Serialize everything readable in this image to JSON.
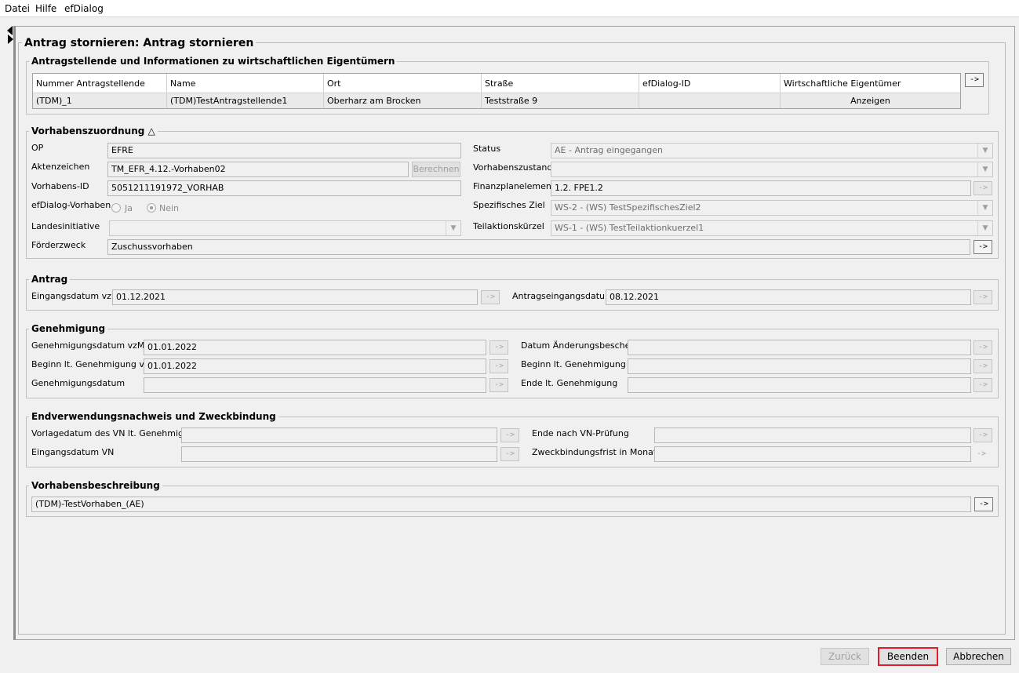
{
  "menu": {
    "datei": "Datei",
    "hilfe": "Hilfe",
    "efdialog": "efDialog"
  },
  "page_title": "Antrag stornieren: Antrag stornieren",
  "applicants": {
    "title": "Antragstellende und Informationen zu wirtschaftlichen Eigentümern",
    "columns": [
      "Nummer Antragstellende",
      "Name",
      "Ort",
      "Straße",
      "efDialog-ID",
      "Wirtschaftliche Eigentümer"
    ],
    "row": [
      "(TDM)_1",
      "(TDM)TestAntragstellende1",
      "Oberharz am Brocken",
      "Teststraße 9",
      "",
      "Anzeigen"
    ],
    "arrow": "->"
  },
  "vorhaben": {
    "title": "Vorhabenszuordnung",
    "op_label": "OP",
    "op_value": "EFRE",
    "akten_label": "Aktenzeichen",
    "akten_value": "TM_EFR_4.12.-Vorhaben02",
    "berechnen": "Berechnen",
    "vid_label": "Vorhabens-ID",
    "vid_value": "5051211191972_VORHAB",
    "efd_label": "efDialog-Vorhaben",
    "ja": "Ja",
    "nein": "Nein",
    "landes_label": "Landesinitiative",
    "landes_value": "",
    "zweck_label": "Förderzweck",
    "zweck_value": "Zuschussvorhaben",
    "status_label": "Status",
    "status_value": "AE - Antrag eingegangen",
    "zustand_label": "Vorhabenszustand",
    "zustand_value": "",
    "fin_label": "Finanzplanelement",
    "fin_value": "1.2. FPE1.2",
    "ziel_label": "Spezifisches Ziel",
    "ziel_value": "WS-2 - (WS) TestSpezifischesZiel2",
    "teil_label": "Teilaktionskürzel",
    "teil_value": "WS-1 - (WS) TestTeilaktionkuerzel1",
    "arrow": "->"
  },
  "antrag": {
    "title": "Antrag",
    "eing_label": "Eingangsdatum vzM",
    "eing_value": "01.12.2021",
    "antr_label": "Antragseingangsdatum",
    "antr_value": "08.12.2021",
    "arrow": "->"
  },
  "genehmigung": {
    "title": "Genehmigung",
    "gdvzm_label": "Genehmigungsdatum vzM",
    "gdvzm_value": "01.01.2022",
    "bgvzm_label": "Beginn lt. Genehmigung vzM",
    "bgvzm_value": "01.01.2022",
    "gd_label": "Genehmigungsdatum",
    "gd_value": "",
    "dab_label": "Datum Änderungsbescheid",
    "dab_value": "",
    "bg_label": "Beginn lt. Genehmigung",
    "bg_value": "",
    "eg_label": "Ende lt. Genehmigung",
    "eg_value": "",
    "arrow": "->"
  },
  "endverwendung": {
    "title": "Endverwendungsnachweis und Zweckbindung",
    "vorlage_label": "Vorlagedatum des VN lt. Genehmigung",
    "vorlage_value": "",
    "eingvn_label": "Eingangsdatum VN",
    "eingvn_value": "",
    "ende_label": "Ende nach VN-Prüfung",
    "ende_value": "",
    "frist_label": "Zweckbindungsfrist in Monaten",
    "frist_value": "",
    "arrow": "->"
  },
  "beschreibung": {
    "title": "Vorhabensbeschreibung",
    "value": "(TDM)-TestVorhaben_(AE)",
    "arrow": "->"
  },
  "buttons": {
    "zurueck": "Zurück",
    "beenden": "Beenden",
    "abbrechen": "Abbrechen"
  },
  "colors": {
    "focus_border": "#e11d2b",
    "panel_bg": "#f0f0f0"
  }
}
